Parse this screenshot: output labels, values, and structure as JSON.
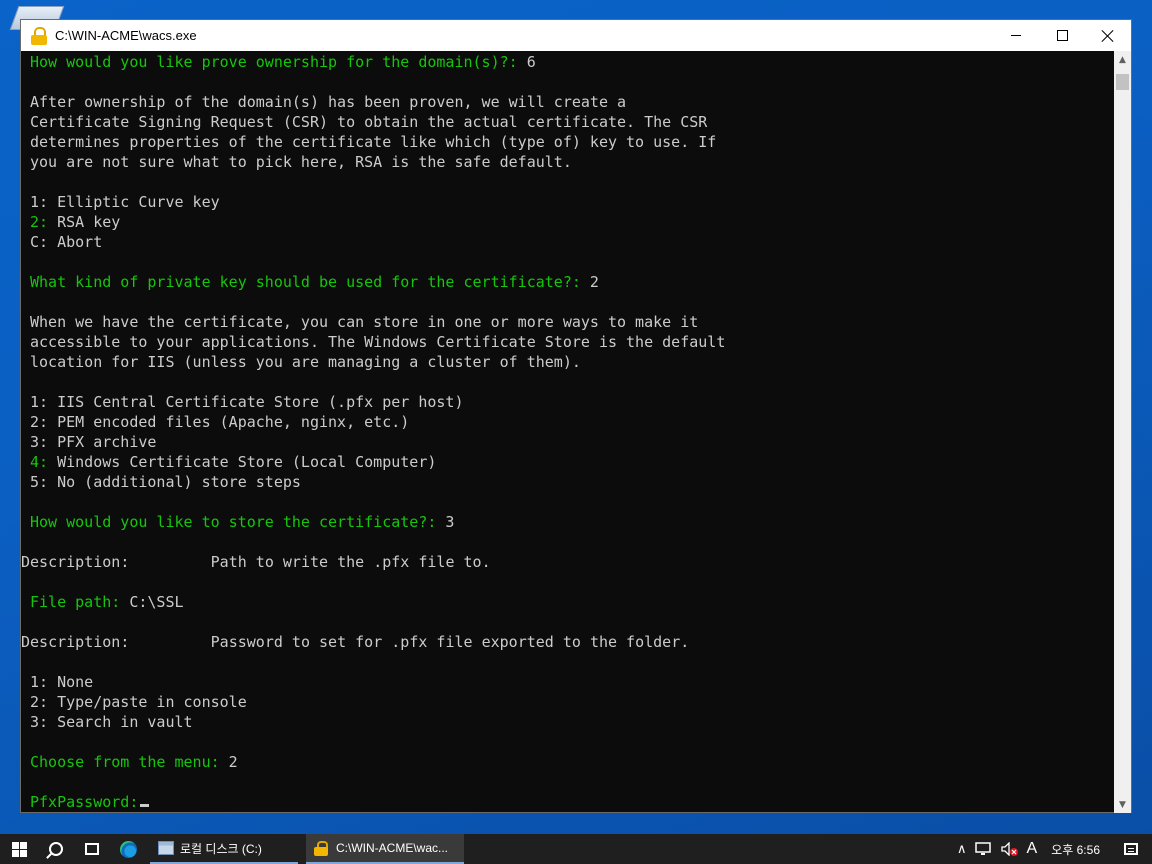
{
  "window": {
    "title": "C:\\WIN-ACME\\wacs.exe"
  },
  "console": {
    "lines": [
      {
        "p": "How would you like prove ownership for the domain(s)?:",
        "v": " 6"
      },
      {
        "t": "After ownership of the domain(s) has been proven, we will create a"
      },
      {
        "t": "Certificate Signing Request (CSR) to obtain the actual certificate. The CSR"
      },
      {
        "t": "determines properties of the certificate like which (type of) key to use. If"
      },
      {
        "t": "you are not sure what to pick here, RSA is the safe default."
      },
      {
        "t": "1: Elliptic Curve key"
      },
      {
        "n": "2:",
        "t": " RSA key"
      },
      {
        "t": "C: Abort"
      },
      {
        "p": "What kind of private key should be used for the certificate?:",
        "v": " 2"
      },
      {
        "t": "When we have the certificate, you can store in one or more ways to make it"
      },
      {
        "t": "accessible to your applications. The Windows Certificate Store is the default"
      },
      {
        "t": "location for IIS (unless you are managing a cluster of them)."
      },
      {
        "t": "1: IIS Central Certificate Store (.pfx per host)"
      },
      {
        "t": "2: PEM encoded files (Apache, nginx, etc.)"
      },
      {
        "t": "3: PFX archive"
      },
      {
        "n": "4:",
        "t": " Windows Certificate Store (Local Computer)"
      },
      {
        "t": "5: No (additional) store steps"
      },
      {
        "p": "How would you like to store the certificate?:",
        "v": " 3"
      },
      {
        "t": "Description:         Path to write the .pfx file to."
      },
      {
        "p": "File path:",
        "v": " C:\\SSL"
      },
      {
        "t": "Description:         Password to set for .pfx file exported to the folder."
      },
      {
        "t": "1: None"
      },
      {
        "t": "2: Type/paste in console"
      },
      {
        "t": "3: Search in vault"
      },
      {
        "p": "Choose from the menu:",
        "v": " 2"
      },
      {
        "p": "PfxPassword:",
        "v": ""
      }
    ]
  },
  "taskbar": {
    "explorer_label": "로컬 디스크 (C:)",
    "active_label": "C:\\WIN-ACME\\wac...",
    "ime_label": "A",
    "clock": "오후 6:56"
  },
  "colors": {
    "prompt_green": "#16c60c",
    "console_bg": "#0c0c0c",
    "console_text": "#cccccc"
  }
}
